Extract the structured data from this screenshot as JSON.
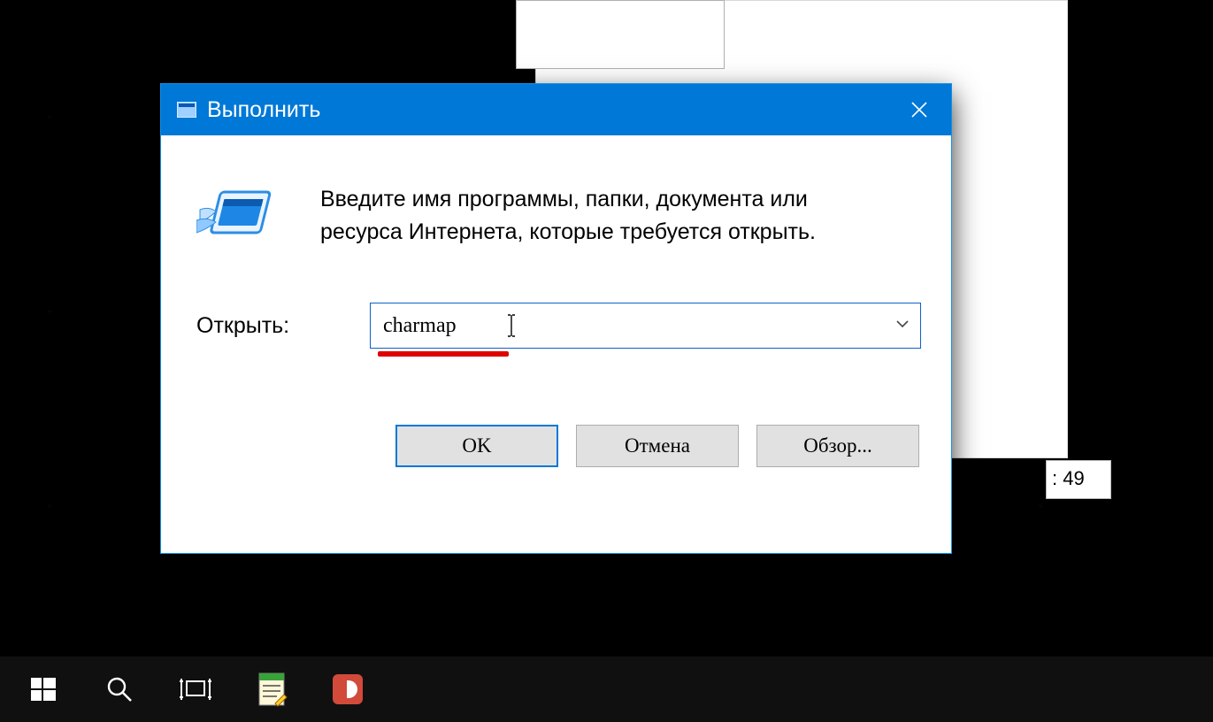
{
  "dialog": {
    "title": "Выполнить",
    "description": "Введите имя программы, папки, документа или ресурса Интернета, которые требуется открыть.",
    "open_label": "Открыть:",
    "input_value": "charmap",
    "buttons": {
      "ok": "OK",
      "cancel": "Отмена",
      "browse": "Обзор..."
    }
  },
  "tooltip_fragment": ": 49",
  "taskbar": {
    "items": [
      "start",
      "search",
      "task-view",
      "notepad-plus",
      "camtasia"
    ]
  },
  "colors": {
    "titlebar": "#0078d7",
    "underline": "#e00000"
  }
}
